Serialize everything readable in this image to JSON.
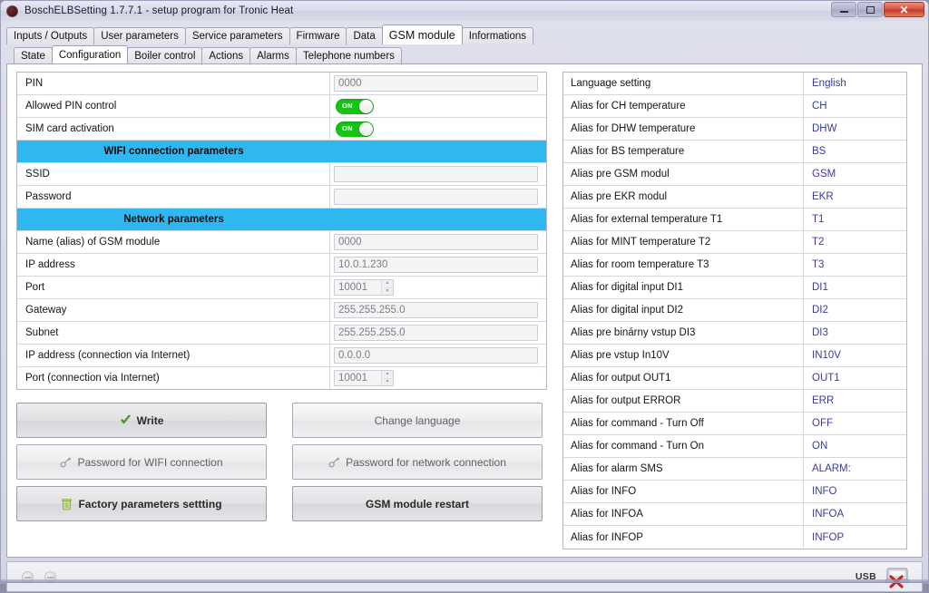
{
  "window": {
    "title": "BoschELBSetting  1.7.7.1 - setup program for Tronic Heat",
    "minimize_label": "minimize",
    "maximize_label": "maximize",
    "close_label": "✕"
  },
  "tabs_primary": [
    {
      "label": "Inputs / Outputs",
      "active": false
    },
    {
      "label": "User parameters",
      "active": false
    },
    {
      "label": "Service parameters",
      "active": false
    },
    {
      "label": "Firmware",
      "active": false
    },
    {
      "label": "Data",
      "active": false
    },
    {
      "label": "GSM module",
      "active": true
    },
    {
      "label": "Informations",
      "active": false
    }
  ],
  "tabs_secondary": [
    {
      "label": "State",
      "active": false
    },
    {
      "label": "Configuration",
      "active": true
    },
    {
      "label": "Boiler control",
      "active": false
    },
    {
      "label": "Actions",
      "active": false
    },
    {
      "label": "Alarms",
      "active": false
    },
    {
      "label": "Telephone numbers",
      "active": false
    }
  ],
  "left_table": [
    {
      "kind": "input",
      "label": "PIN",
      "value": "0000",
      "width": "wide"
    },
    {
      "kind": "toggle",
      "label": "Allowed PIN control",
      "value": "ON"
    },
    {
      "kind": "toggle",
      "label": "SIM card activation",
      "value": "ON"
    },
    {
      "kind": "section",
      "label": "WIFI connection parameters"
    },
    {
      "kind": "input",
      "label": "SSID",
      "value": "",
      "width": "wide"
    },
    {
      "kind": "input",
      "label": "Password",
      "value": "",
      "width": "wide"
    },
    {
      "kind": "section",
      "label": "Network parameters"
    },
    {
      "kind": "input",
      "label": "Name (alias) of GSM module",
      "value": "0000",
      "width": "wide"
    },
    {
      "kind": "input",
      "label": "IP address",
      "value": "10.0.1.230",
      "width": "wide"
    },
    {
      "kind": "spin",
      "label": "Port",
      "value": "10001"
    },
    {
      "kind": "input",
      "label": "Gateway",
      "value": "255.255.255.0",
      "width": "wide"
    },
    {
      "kind": "input",
      "label": "Subnet",
      "value": "255.255.255.0",
      "width": "wide"
    },
    {
      "kind": "input",
      "label": "IP address (connection via Internet)",
      "value": "0.0.0.0",
      "width": "wide"
    },
    {
      "kind": "spin",
      "label": "Port (connection via Internet)",
      "value": "10001"
    }
  ],
  "buttons": {
    "write": "Write",
    "password_wifi": "Password for WIFI connection",
    "factory_reset": "Factory parameters settting",
    "change_language": "Change language",
    "password_network": "Password for network connection",
    "gsm_restart": "GSM module restart"
  },
  "right_table": [
    {
      "label": "Language setting",
      "value": "English"
    },
    {
      "label": "Alias for CH temperature",
      "value": "CH"
    },
    {
      "label": "Alias for DHW temperature",
      "value": "DHW"
    },
    {
      "label": "Alias for BS temperature",
      "value": "BS"
    },
    {
      "label": "Alias pre GSM modul",
      "value": "GSM"
    },
    {
      "label": "Alias pre EKR modul",
      "value": "EKR"
    },
    {
      "label": "Alias for external temperature T1",
      "value": "T1"
    },
    {
      "label": "Alias for MINT temperature T2",
      "value": "T2"
    },
    {
      "label": "Alias for room temperature T3",
      "value": "T3"
    },
    {
      "label": "Alias for digital input DI1",
      "value": "DI1"
    },
    {
      "label": "Alias for digital input DI2",
      "value": "DI2"
    },
    {
      "label": "Alias pre binárny vstup DI3",
      "value": "DI3"
    },
    {
      "label": "Alias pre vstup In10V",
      "value": "IN10V"
    },
    {
      "label": "Alias for output OUT1",
      "value": "OUT1"
    },
    {
      "label": "Alias for output ERROR",
      "value": "ERR"
    },
    {
      "label": "Alias for command - Turn Off",
      "value": "OFF"
    },
    {
      "label": "Alias for command - Turn On",
      "value": "ON"
    },
    {
      "label": "Alias for alarm SMS",
      "value": "ALARM:"
    },
    {
      "label": "Alias for INFO",
      "value": "INFO"
    },
    {
      "label": "Alias for INFOA",
      "value": "INFOA"
    },
    {
      "label": "Alias for INFOP",
      "value": "INFOP"
    }
  ],
  "statusbar": {
    "usb_label": "USB"
  },
  "colors": {
    "section_blue": "#2fb8ef",
    "value_text": "#3b3b9e",
    "toggle_on": "#15c415",
    "close_button": "#d9503a"
  }
}
